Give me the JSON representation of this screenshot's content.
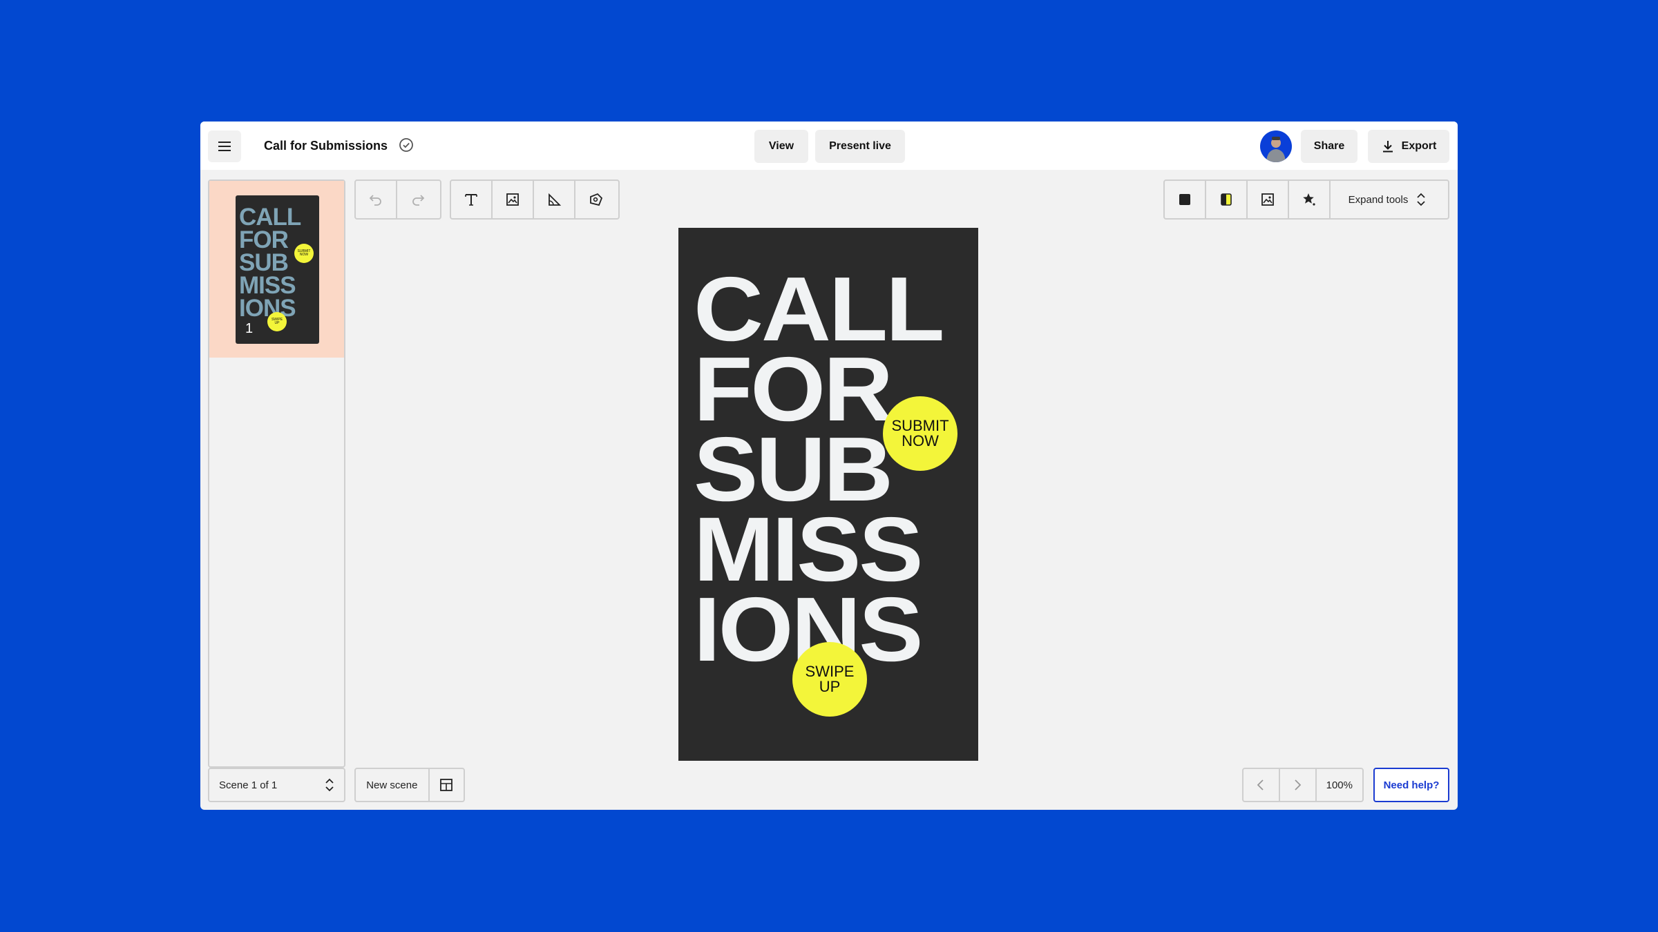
{
  "header": {
    "title": "Call for Submissions",
    "view_label": "View",
    "present_label": "Present live",
    "share_label": "Share",
    "export_label": "Export"
  },
  "toolbar": {
    "left_tools": [
      "undo-icon",
      "redo-icon"
    ],
    "insert_tools": [
      "text-icon",
      "image-icon",
      "shape-icon",
      "sticker-icon"
    ],
    "right_tools": [
      "background-color-icon",
      "color-palette-icon",
      "image-icon",
      "effects-icon"
    ],
    "expand_label": "Expand tools"
  },
  "scenes": {
    "thumb_number": "1",
    "thumb_lines": [
      "CALL",
      "FOR",
      "SUB",
      "MISS",
      "IONS"
    ],
    "selector_label": "Scene 1 of 1",
    "new_scene_label": "New scene"
  },
  "design": {
    "lines": [
      "CALL",
      "FOR",
      "SUB",
      "MISS",
      "IONS"
    ],
    "badge_top": [
      "SUBMIT",
      "NOW"
    ],
    "badge_bottom": [
      "SWIPE",
      "UP"
    ],
    "badge_color": "#f3f53a",
    "background_color": "#2b2b2b"
  },
  "footer": {
    "zoom": "100%",
    "help_label": "Need help?"
  },
  "colors": {
    "page_background": "#0248d0",
    "accent": "#1a3bd1",
    "selected_scene": "#fbd8c6"
  }
}
